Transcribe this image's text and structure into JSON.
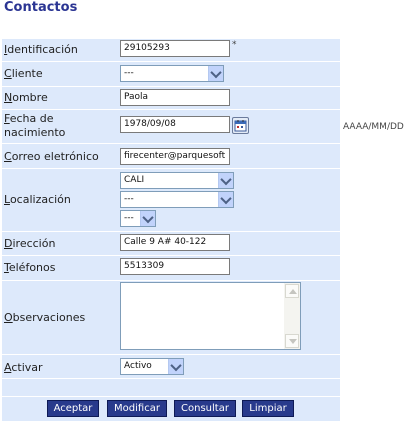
{
  "page": {
    "title": "Contactos"
  },
  "form": {
    "identificacion": {
      "label": "Identificación",
      "value": "29105293",
      "required_mark": "*"
    },
    "cliente": {
      "label": "Cliente",
      "value": "---"
    },
    "nombre": {
      "label": "Nombre",
      "value": "Paola"
    },
    "fecha": {
      "label_line1": "Fecha de",
      "label_line2": "nacimiento",
      "value": "1978/09/08",
      "format_hint": "AAAA/MM/DD"
    },
    "correo": {
      "label": "Correo eletrónico",
      "value": "firecenter@parquesoft"
    },
    "localizacion": {
      "label": "Localización",
      "ciudad": "CALI",
      "select2": "---",
      "select3": "---"
    },
    "direccion": {
      "label": "Dirección",
      "value": "Calle 9 A# 40-122"
    },
    "telefonos": {
      "label": "Teléfonos",
      "value": "5513309"
    },
    "observaciones": {
      "label": "Observaciones",
      "value": ""
    },
    "activar": {
      "label": "Activar",
      "value": "Activo"
    }
  },
  "buttons": {
    "aceptar": "Aceptar",
    "modificar": "Modificar",
    "consultar": "Consultar",
    "limpiar": "Limpiar"
  },
  "icons": {
    "calendar": "calendar-icon",
    "dropdown": "chevron-down-icon"
  },
  "colors": {
    "title": "#2b3593",
    "form_bg": "#dde9fb",
    "button_bg": "#283a8c"
  }
}
